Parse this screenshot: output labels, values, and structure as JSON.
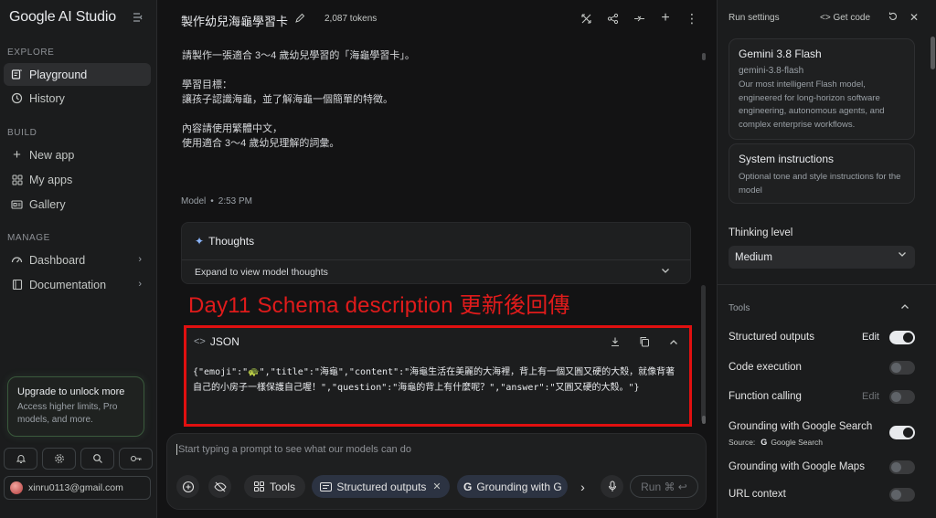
{
  "sidebar": {
    "brand": "Google AI Studio",
    "sections": {
      "explore": "EXPLORE",
      "build": "BUILD",
      "manage": "MANAGE"
    },
    "items": {
      "playground": "Playground",
      "history": "History",
      "new_app": "New app",
      "my_apps": "My apps",
      "gallery": "Gallery",
      "dashboard": "Dashboard",
      "documentation": "Documentation"
    },
    "upgrade": {
      "title": "Upgrade to unlock more",
      "desc": "Access higher limits, Pro models, and more."
    },
    "account_email": "xinru0113@gmail.com"
  },
  "main": {
    "title": "製作幼兒海龜學習卡",
    "tokens": "2,087 tokens",
    "prompt_lines": [
      "請製作一張適合 3～4 歲幼兒學習的「海龜學習卡」。",
      "學習目標：",
      "讓孩子認識海龜，並了解海龜一個簡單的特徵。",
      "內容請使用繁體中文，",
      "使用適合 3～4 歲幼兒理解的詞彙。"
    ],
    "model_label": "Model",
    "model_time": "2:53 PM",
    "thoughts_title": "Thoughts",
    "thoughts_expand": "Expand to view model thoughts",
    "annotation": "Day11 Schema description 更新後回傳",
    "json_label": "JSON",
    "json_code": "{\"emoji\":\"🐢\",\"title\":\"海龜\",\"content\":\"海龜生活在美麗的大海裡，背上有一個又圓又硬的大殼，就像背著自己的小房子一樣保護自己喔！\",\"question\":\"海龜的背上有什麼呢？\",\"answer\":\"又圓又硬的大殼。\"}",
    "composer_placeholder": "Start typing a prompt to see what our models can do",
    "chips": {
      "tools": "Tools",
      "structured": "Structured outputs",
      "grounding": "Grounding with G"
    },
    "run_label": "Run ⌘ ↩"
  },
  "right": {
    "run_settings": "Run settings",
    "get_code": "Get code",
    "model_card": {
      "title": "Gemini 3.8 Flash",
      "id": "gemini-3.8-flash",
      "desc": "Our most intelligent Flash model, engineered for long-horizon software engineering, autonomous agents, and complex enterprise workflows."
    },
    "system_card": {
      "title": "System instructions",
      "desc": "Optional tone and style instructions for the model"
    },
    "thinking_label": "Thinking level",
    "thinking_value": "Medium",
    "tools_label": "Tools",
    "edit_label": "Edit",
    "source_label": "Source:",
    "source_value": "Google Search",
    "tools": [
      {
        "label": "Structured outputs",
        "on": true
      },
      {
        "label": "Code execution",
        "on": false
      },
      {
        "label": "Function calling",
        "on": false
      },
      {
        "label": "Grounding with Google Search",
        "on": true
      },
      {
        "label": "Grounding with Google Maps",
        "on": false
      },
      {
        "label": "URL context",
        "on": false
      }
    ]
  }
}
